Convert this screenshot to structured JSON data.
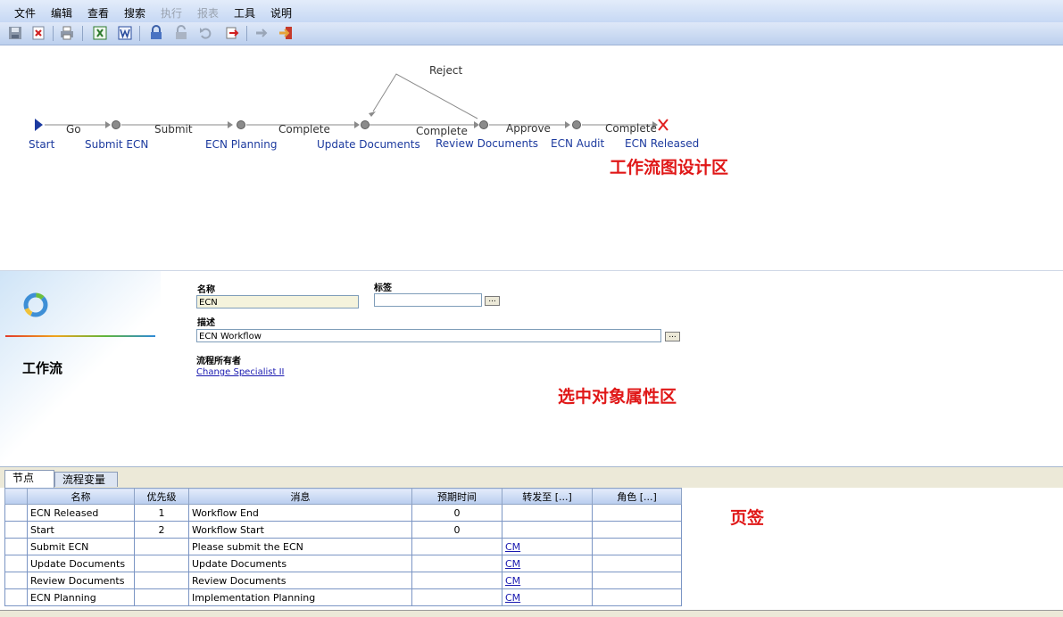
{
  "menu": {
    "items": [
      {
        "label": "文件"
      },
      {
        "label": "编辑"
      },
      {
        "label": "查看"
      },
      {
        "label": "搜索"
      },
      {
        "label": "执行",
        "disabled": true
      },
      {
        "label": "报表",
        "disabled": true
      },
      {
        "label": "工具"
      },
      {
        "label": "说明"
      }
    ]
  },
  "toolbar": {
    "icons": [
      "save-icon",
      "close-doc-icon",
      "print-icon",
      "excel-export-icon",
      "word-export-icon",
      "lock-icon",
      "unlock-icon",
      "undo-icon",
      "revert-icon",
      "logout-icon",
      "exit-icon"
    ]
  },
  "workflow": {
    "nodes": [
      {
        "label": "Start"
      },
      {
        "label": "Submit ECN"
      },
      {
        "label": "ECN Planning"
      },
      {
        "label": "Update Documents"
      },
      {
        "label": "Review Documents"
      },
      {
        "label": "ECN Audit"
      },
      {
        "label": "ECN Released"
      }
    ],
    "transitions": [
      "Go",
      "Submit",
      "Complete",
      "Complete",
      "Approve",
      "Complete",
      "Reject"
    ],
    "annotation": "工作流图设计区"
  },
  "properties": {
    "section_title": "工作流",
    "name_label": "名称",
    "name_value": "ECN",
    "tag_label": "标签",
    "tag_value": "",
    "desc_label": "描述",
    "desc_value": "ECN Workflow",
    "owner_label": "流程所有者",
    "owner_value": "Change Specialist II",
    "browse_label": "...",
    "annotation": "选中对象属性区"
  },
  "tabs": {
    "items": [
      {
        "label": "节点"
      },
      {
        "label": "流程变量"
      }
    ],
    "annotation": "页签",
    "columns": [
      "名称",
      "优先级",
      "消息",
      "预期时间",
      "转发至 [...]",
      "角色 [...]"
    ],
    "rows": [
      {
        "name": "ECN Released",
        "priority": "1",
        "message": "Workflow End",
        "time": "0",
        "forward": "",
        "role": ""
      },
      {
        "name": "Start",
        "priority": "2",
        "message": "Workflow Start",
        "time": "0",
        "forward": "",
        "role": ""
      },
      {
        "name": "Submit ECN",
        "priority": "",
        "message": "Please submit the ECN",
        "time": "",
        "forward": "CM",
        "role": ""
      },
      {
        "name": "Update Documents",
        "priority": "",
        "message": "Update Documents",
        "time": "",
        "forward": "CM",
        "role": ""
      },
      {
        "name": "Review Documents",
        "priority": "",
        "message": "Review Documents",
        "time": "",
        "forward": "CM",
        "role": ""
      },
      {
        "name": "ECN Planning",
        "priority": "",
        "message": "Implementation Planning",
        "time": "",
        "forward": "CM",
        "role": ""
      }
    ]
  }
}
